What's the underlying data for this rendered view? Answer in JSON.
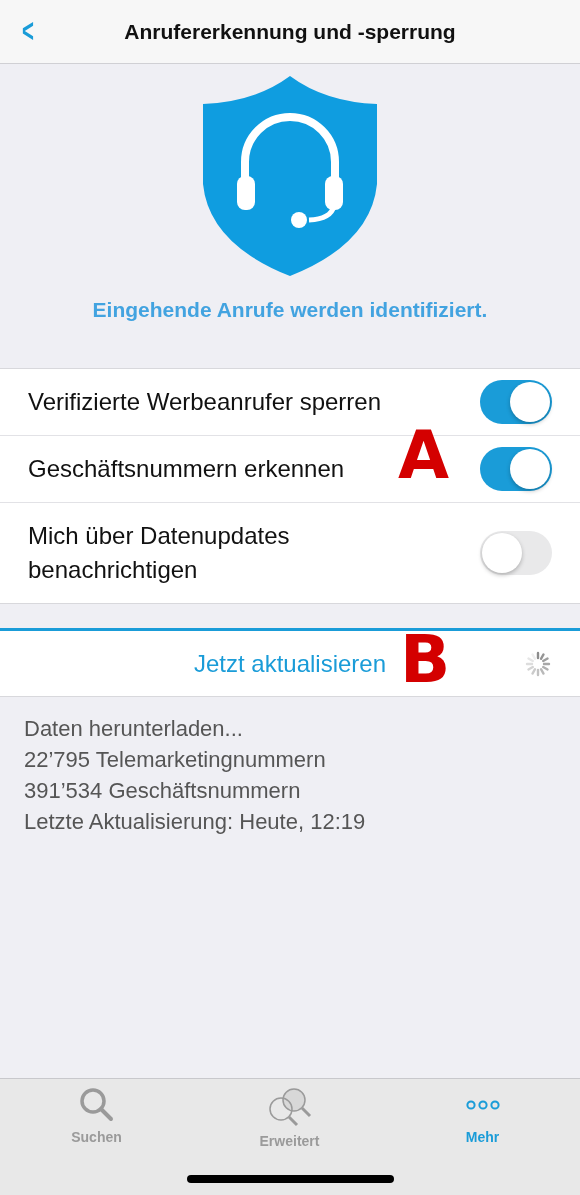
{
  "nav": {
    "back": "<",
    "title": "Anrufererkennung und -sperrung"
  },
  "header": {
    "status": "Eingehende Anrufe werden identifiziert."
  },
  "settings": [
    {
      "label": "Verifizierte Werbeanrufer sperren",
      "on": true
    },
    {
      "label": "Geschäftsnummern erkennen",
      "on": true
    },
    {
      "label": "Mich über Datenupdates benachrichtigen",
      "on": false
    }
  ],
  "update": {
    "progress": {
      "level": 1
    },
    "button": "Jetzt aktualisieren",
    "loading": true
  },
  "info": [
    "Daten herunterladen...",
    "22’795 Telemarketingnummern",
    "391’534 Geschäftsnummern",
    "Letzte Aktualisierung: Heute, 12:19"
  ],
  "annotations": [
    {
      "label": "A"
    },
    {
      "label": "B"
    }
  ],
  "tabs": [
    {
      "label": "Suchen",
      "kind": "search",
      "selected": false
    },
    {
      "label": "Erweitert",
      "kind": "advanced",
      "selected": false
    },
    {
      "label": "Mehr",
      "kind": "more",
      "selected": true
    }
  ]
}
